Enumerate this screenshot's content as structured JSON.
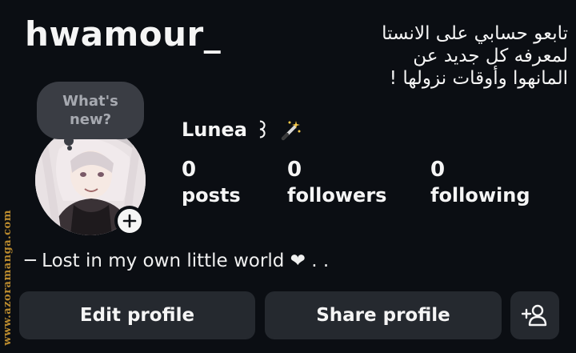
{
  "header": {
    "username": "hwamour_"
  },
  "promo": {
    "line1": "تابعو حسابي على الانستا",
    "line2": "لمعرفه كل جديد عن",
    "line3": "المانهوا وأوقات نزولها !"
  },
  "note": {
    "text": "What's new?"
  },
  "profile": {
    "display_name": "Lunea",
    "name_suffix": "꒱"
  },
  "stats": [
    {
      "value": "0",
      "label": "posts"
    },
    {
      "value": "0",
      "label": "followers"
    },
    {
      "value": "0",
      "label": "following"
    }
  ],
  "bio": {
    "text": "─ Lost in my own little world ❤ . ."
  },
  "actions": {
    "edit_label": "Edit profile",
    "share_label": "Share profile"
  },
  "watermark": {
    "text": "www.azoramanga.com"
  },
  "colors": {
    "background": "#0b0e13",
    "button": "#25292f",
    "note_bubble": "#3a3d44",
    "watermark": "#b98a2e"
  },
  "icons": {
    "add_story": "plus-icon",
    "display_name_decoration": "magic-wand-icon",
    "discover_people": "add-person-icon"
  }
}
